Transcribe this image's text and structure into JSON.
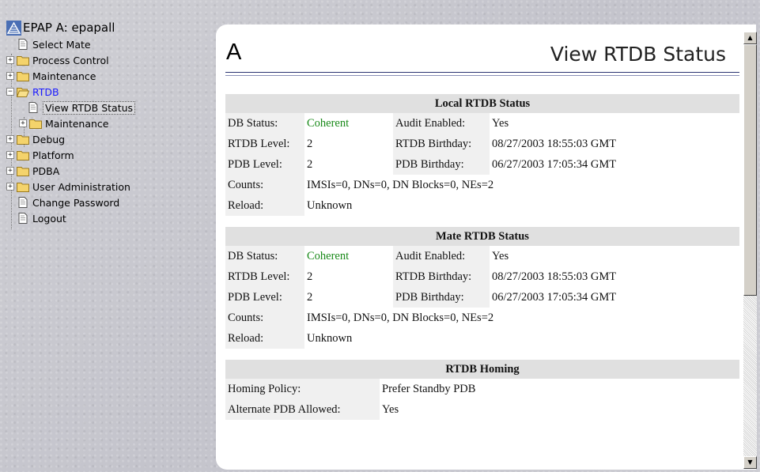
{
  "tree": {
    "root_label": "EPAP A: epapall",
    "items": [
      {
        "label": "Select Mate"
      },
      {
        "label": "Process Control"
      },
      {
        "label": "Maintenance"
      },
      {
        "label": "RTDB"
      },
      {
        "label": "View RTDB Status"
      },
      {
        "label": "Maintenance"
      },
      {
        "label": "Debug"
      },
      {
        "label": "Platform"
      },
      {
        "label": "PDBA"
      },
      {
        "label": "User Administration"
      },
      {
        "label": "Change Password"
      },
      {
        "label": "Logout"
      }
    ]
  },
  "header": {
    "letter": "A",
    "title": "View RTDB Status"
  },
  "local": {
    "heading": "Local RTDB Status",
    "db_status_label": "DB Status:",
    "db_status": "Coherent",
    "audit_label": "Audit Enabled:",
    "audit": "Yes",
    "rtdb_level_label": "RTDB Level:",
    "rtdb_level": "2",
    "rtdb_birthday_label": "RTDB Birthday:",
    "rtdb_birthday": "08/27/2003 18:55:03 GMT",
    "pdb_level_label": "PDB Level:",
    "pdb_level": "2",
    "pdb_birthday_label": "PDB Birthday:",
    "pdb_birthday": "06/27/2003 17:05:34 GMT",
    "counts_label": "Counts:",
    "counts": "IMSIs=0, DNs=0, DN Blocks=0, NEs=2",
    "reload_label": "Reload:",
    "reload": "Unknown"
  },
  "mate": {
    "heading": "Mate RTDB Status",
    "db_status_label": "DB Status:",
    "db_status": "Coherent",
    "audit_label": "Audit Enabled:",
    "audit": "Yes",
    "rtdb_level_label": "RTDB Level:",
    "rtdb_level": "2",
    "rtdb_birthday_label": "RTDB Birthday:",
    "rtdb_birthday": "08/27/2003 18:55:03 GMT",
    "pdb_level_label": "PDB Level:",
    "pdb_level": "2",
    "pdb_birthday_label": "PDB Birthday:",
    "pdb_birthday": "06/27/2003 17:05:34 GMT",
    "counts_label": "Counts:",
    "counts": "IMSIs=0, DNs=0, DN Blocks=0, NEs=2",
    "reload_label": "Reload:",
    "reload": "Unknown"
  },
  "homing": {
    "heading": "RTDB Homing",
    "policy_label": "Homing Policy:",
    "policy": "Prefer Standby PDB",
    "alt_label": "Alternate PDB Allowed:",
    "alt": "Yes"
  },
  "colors": {
    "coherent": "#1a8a1a",
    "active_link": "#1a1aff"
  },
  "icons": {
    "root": "epap-app-icon",
    "folder": "folder-icon",
    "page": "page-icon"
  }
}
